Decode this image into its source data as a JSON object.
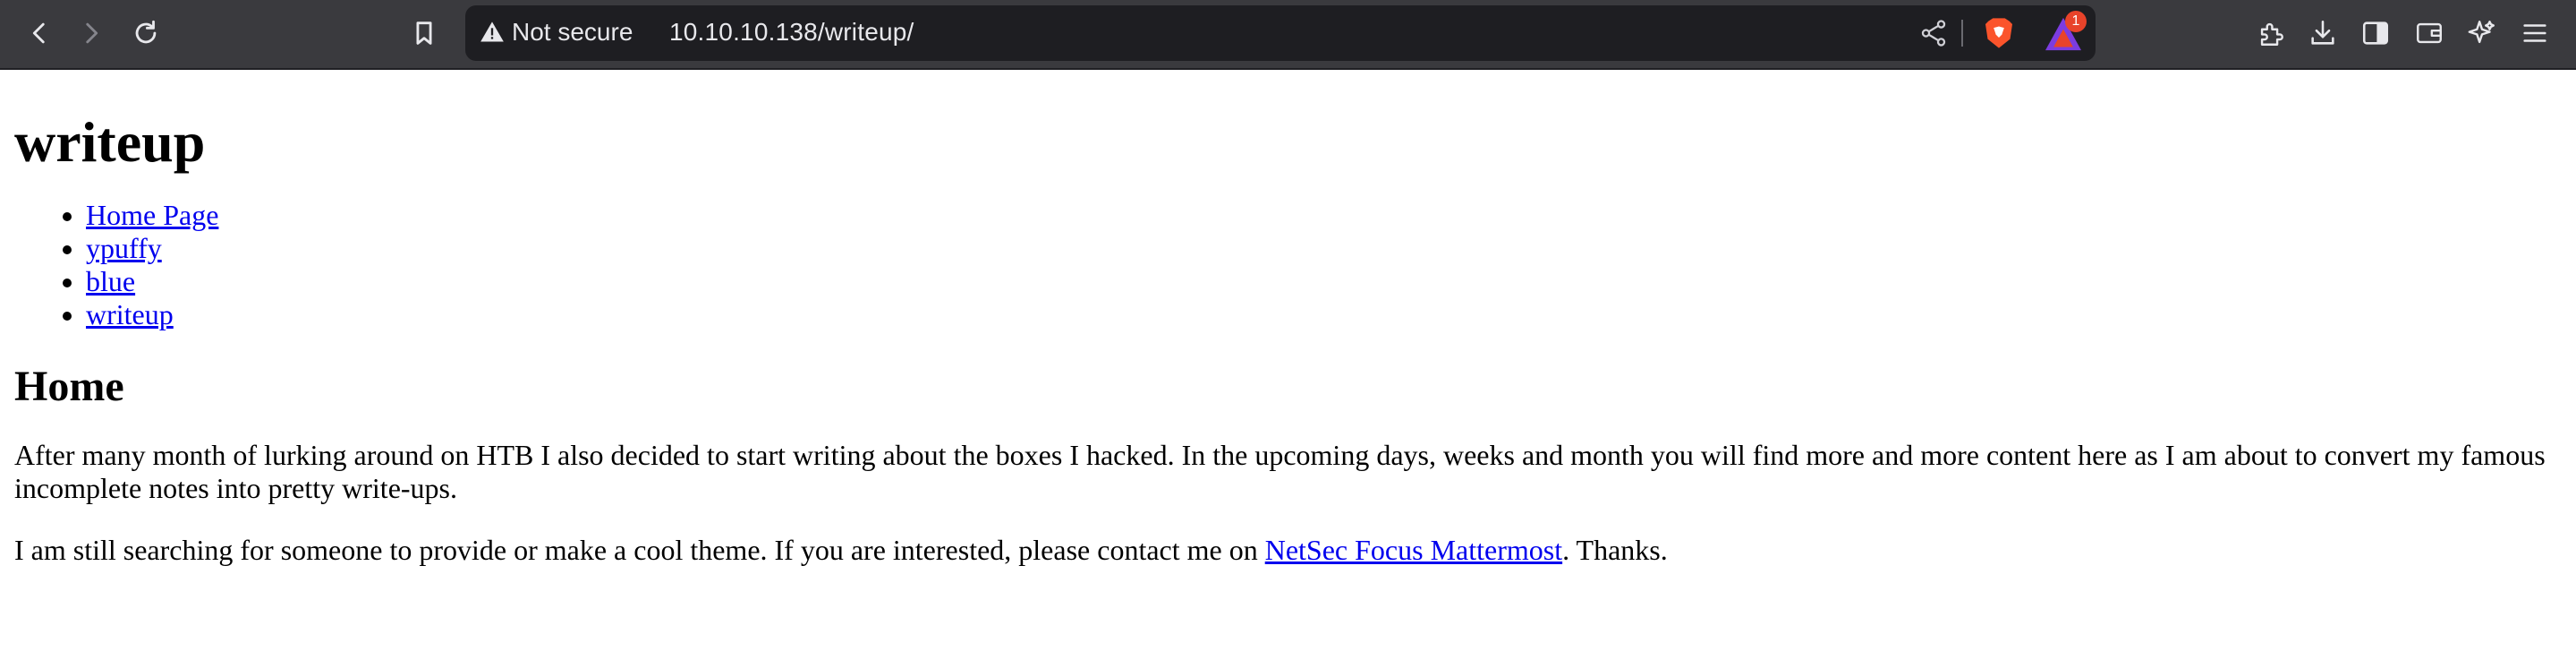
{
  "browser": {
    "nav": {
      "back_icon": "chevron-left-icon",
      "forward_icon": "chevron-right-icon",
      "reload_icon": "reload-icon",
      "bookmark_icon": "bookmark-icon"
    },
    "address_bar": {
      "security_label": "Not secure",
      "url": "10.10.10.138/writeup/",
      "rewards_badge_count": "1"
    },
    "colors": {
      "toolbar_bg": "#3a3a3e",
      "urlbar_bg": "#1e1e22",
      "brave_orange": "#fb542b",
      "badge_red": "#e8432a"
    }
  },
  "page": {
    "title": "writeup",
    "nav_links": [
      {
        "label": "Home Page"
      },
      {
        "label": "ypuffy"
      },
      {
        "label": "blue"
      },
      {
        "label": "writeup"
      }
    ],
    "section_heading": "Home",
    "intro_paragraph": "After many month of lurking around on HTB I also decided to start writing about the boxes I hacked. In the upcoming days, weeks and month you will find more and more content here as I am about to convert my famous incomplete notes into pretty write-ups.",
    "contact_paragraph": {
      "before_link": "I am still searching for someone to provide or make a cool theme. If you are interested, please contact me on ",
      "link_text": "NetSec Focus Mattermost",
      "after_link": ". Thanks."
    },
    "colors": {
      "link": "#0000ee",
      "text": "#000000"
    }
  }
}
